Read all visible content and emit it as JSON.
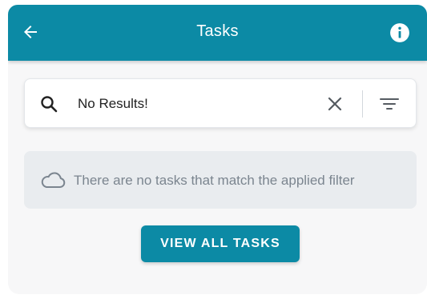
{
  "header": {
    "title": "Tasks",
    "back_icon": "arrow-left-icon",
    "info_icon": "info-circle-icon"
  },
  "search": {
    "value": "No Results!",
    "search_icon": "search-icon",
    "clear_icon": "close-icon",
    "filter_icon": "filter-icon"
  },
  "empty_state": {
    "icon": "cloud-icon",
    "message": "There are no tasks that match the applied filter"
  },
  "actions": {
    "view_all_label": "VIEW ALL TASKS"
  },
  "colors": {
    "primary": "#0c8aa5",
    "background": "#f7f7f8",
    "empty_box": "#e9ecef",
    "muted_text": "#7b858f"
  }
}
